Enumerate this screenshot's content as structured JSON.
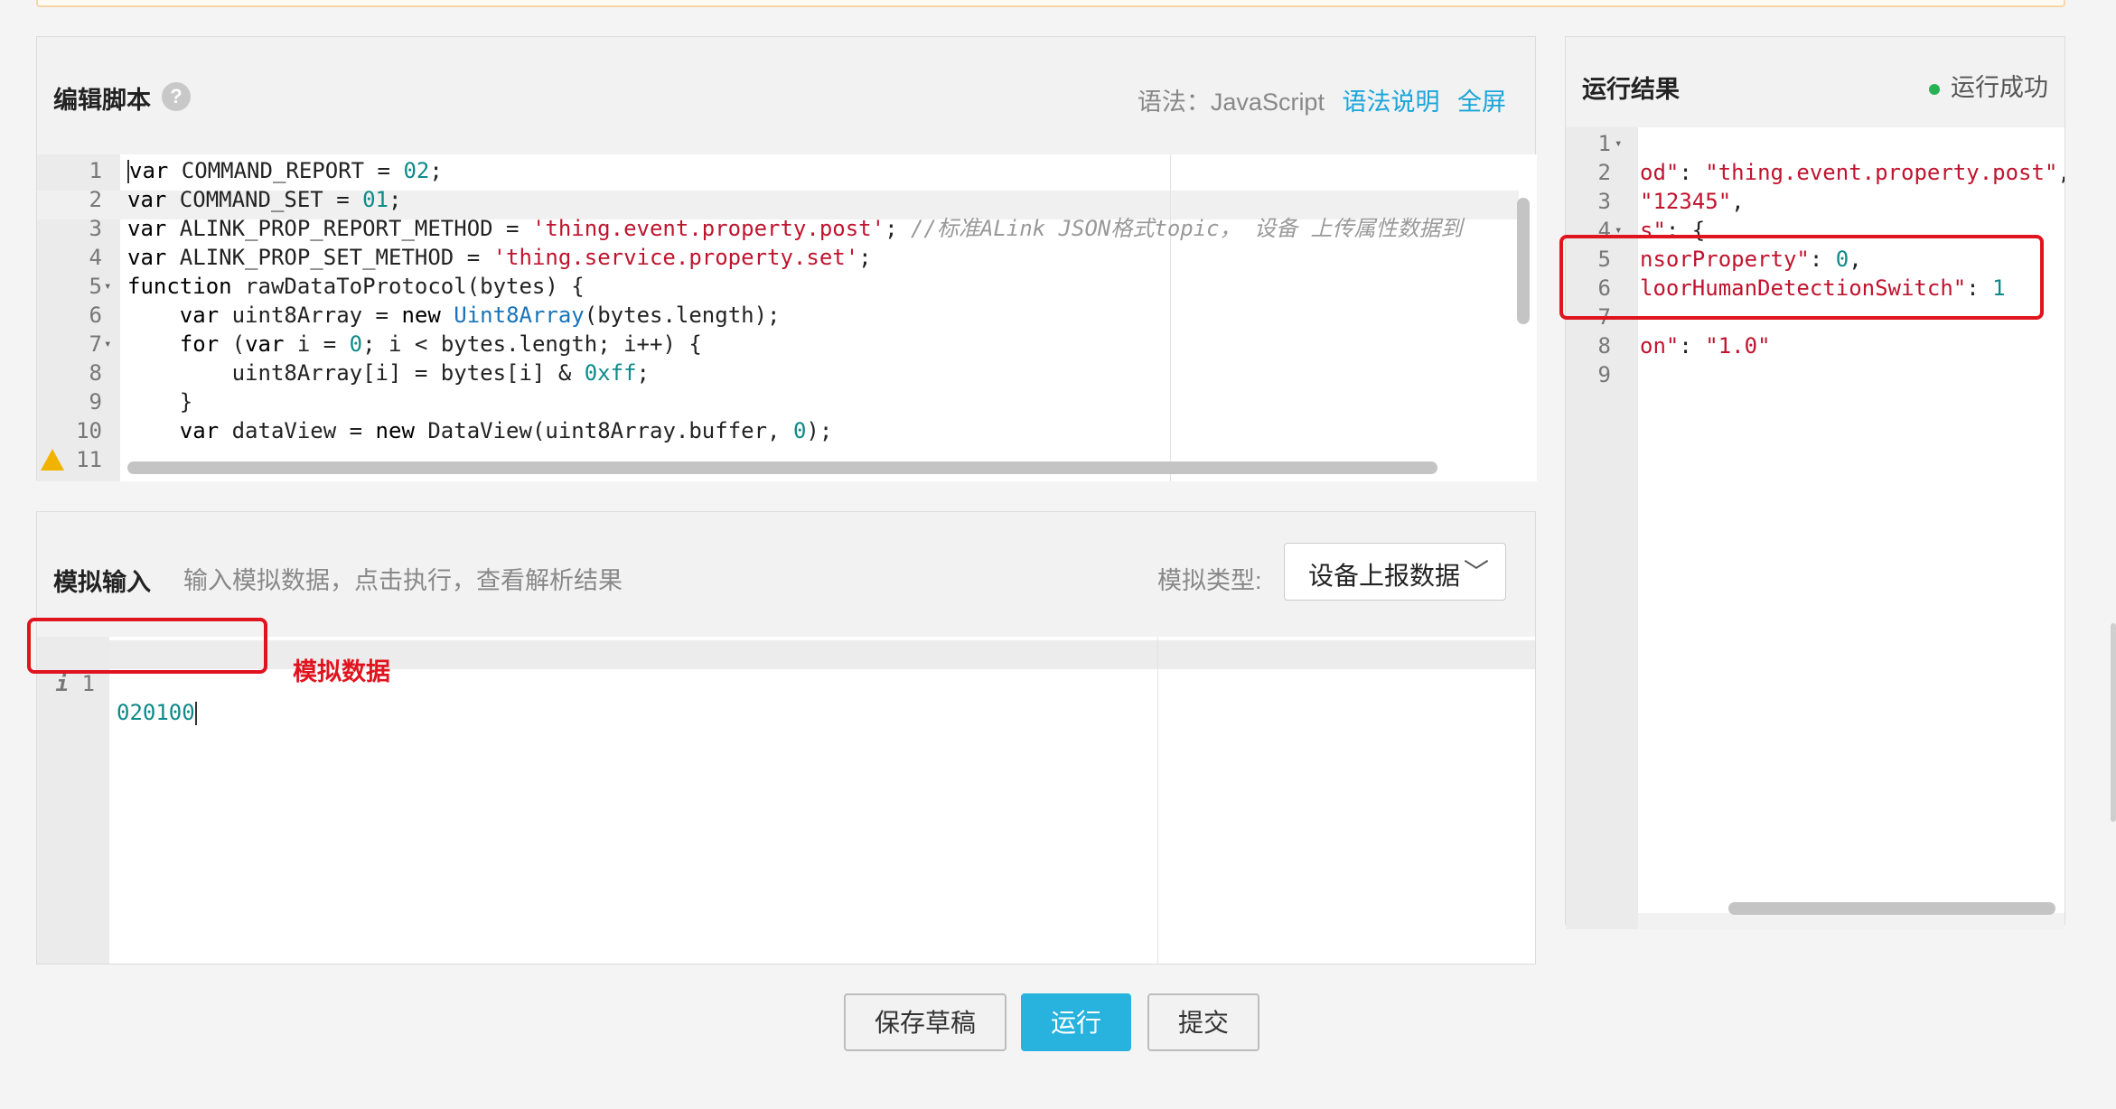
{
  "editor": {
    "title": "编辑脚本",
    "help_icon": "?",
    "syntax_label": "语法：JavaScript",
    "syntax_help_link": "语法说明",
    "fullscreen_link": "全屏",
    "lines": [
      {
        "n": "1"
      },
      {
        "n": "2"
      },
      {
        "n": "3"
      },
      {
        "n": "4"
      },
      {
        "n": "5"
      },
      {
        "n": "6"
      },
      {
        "n": "7"
      },
      {
        "n": "8"
      },
      {
        "n": "9"
      },
      {
        "n": "10"
      },
      {
        "n": "11"
      }
    ],
    "code": {
      "l1": [
        "var",
        " COMMAND_REPORT = ",
        "02",
        ";"
      ],
      "l2": [
        "var",
        " COMMAND_SET = ",
        "01",
        ";"
      ],
      "l3": [
        "var",
        " ALINK_PROP_REPORT_METHOD = ",
        "'thing.event.property.post'",
        "; ",
        "//标准ALink JSON格式topic， 设备 上传属性数据到"
      ],
      "l4": [
        "var",
        " ALINK_PROP_SET_METHOD = ",
        "'thing.service.property.set'",
        ";"
      ],
      "l5": [
        "function",
        " rawDataToProtocol(bytes) {"
      ],
      "l6": [
        "    var",
        " uint8Array = ",
        "new",
        " ",
        "Uint8Array",
        "(bytes.length);"
      ],
      "l7": [
        "    for",
        " (",
        "var",
        " i = ",
        "0",
        "; i < bytes.length; i++) {"
      ],
      "l8": [
        "        uint8Array[i] = bytes[i] & ",
        "0xff",
        ";"
      ],
      "l9": [
        "    }"
      ],
      "l10": [
        "    var",
        " dataView = ",
        "new",
        " DataView(uint8Array.buffer, ",
        "0",
        ");"
      ]
    }
  },
  "result": {
    "title": "运行结果",
    "status": "运行成功",
    "status_color": "#27b255",
    "lines": [
      {
        "n": "1",
        "fold": "▾",
        "text": ""
      },
      {
        "n": "2",
        "fold": "",
        "key": "od\"",
        "sep": ": ",
        "val": "\"thing.event.property.post\"",
        "tail": ","
      },
      {
        "n": "3",
        "fold": "",
        "key": "",
        "sep": "",
        "val": "\"12345\"",
        "tail": ","
      },
      {
        "n": "4",
        "fold": "▾",
        "key": "s\"",
        "sep": ": {",
        "val": "",
        "tail": ""
      },
      {
        "n": "5",
        "fold": "",
        "key": "nsorProperty\"",
        "sep": ": ",
        "num": "0",
        "tail": ","
      },
      {
        "n": "6",
        "fold": "",
        "key": "loorHumanDetectionSwitch\"",
        "sep": ": ",
        "num": "1",
        "tail": ""
      },
      {
        "n": "7",
        "fold": "",
        "key": "",
        "sep": "",
        "val": "",
        "tail": ""
      },
      {
        "n": "8",
        "fold": "",
        "key": "on\"",
        "sep": ": ",
        "val": "\"1.0\"",
        "tail": ""
      },
      {
        "n": "9",
        "fold": "",
        "key": "",
        "sep": "",
        "val": "",
        "tail": ""
      }
    ]
  },
  "simulate": {
    "title": "模拟输入",
    "hint": "输入模拟数据，点击执行，查看解析结果",
    "type_label": "模拟类型:",
    "type_value": "设备上报数据",
    "line_number": "1",
    "info_icon": "i",
    "input_value": "020100",
    "annotation": "模拟数据"
  },
  "actions": {
    "save_draft": "保存草稿",
    "run": "运行",
    "submit": "提交"
  },
  "colors": {
    "accent": "#27b3dd",
    "annotation_red": "#e0141e"
  }
}
